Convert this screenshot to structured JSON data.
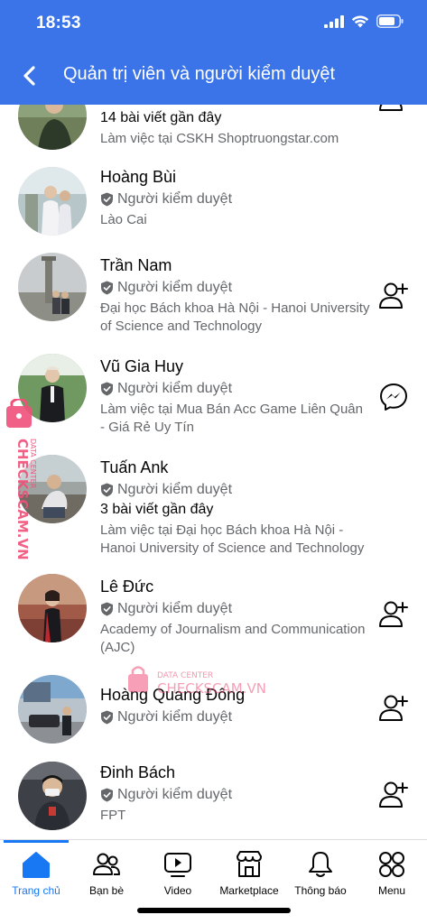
{
  "status": {
    "time": "18:53"
  },
  "header": {
    "title": "Quản trị viên và người kiểm duyệt"
  },
  "members": [
    {
      "name": "",
      "posts": "14 bài viết gần đây",
      "meta": "Làm việc tại CSKH Shoptruongstar.com",
      "action": "add-friend"
    },
    {
      "name": "Hoàng Bùi",
      "role": "Người kiểm duyệt",
      "meta": "Lào Cai",
      "action": "none"
    },
    {
      "name": "Trần Nam",
      "role": "Người kiểm duyệt",
      "meta": "Đại học Bách khoa Hà Nội - Hanoi University of Science and Technology",
      "action": "add-friend"
    },
    {
      "name": "Vũ Gia Huy",
      "role": "Người kiểm duyệt",
      "meta": "Làm việc tại Mua Bán Acc Game Liên Quân - Giá Rẻ Uy Tín",
      "action": "messenger"
    },
    {
      "name": "Tuấn Ank",
      "role": "Người kiểm duyệt",
      "posts": "3 bài viết gần đây",
      "meta": "Làm việc tại Đại học Bách khoa Hà Nội - Hanoi University of Science and Technology",
      "action": "none"
    },
    {
      "name": "Lê Đức",
      "role": "Người kiểm duyệt",
      "meta": "Academy of Journalism and Communication (AJC)",
      "action": "add-friend"
    },
    {
      "name": "Hoàng Quang Đông",
      "role": "Người kiểm duyệt",
      "meta": "",
      "action": "add-friend"
    },
    {
      "name": "Đinh Bách",
      "role": "Người kiểm duyệt",
      "meta": "FPT",
      "action": "add-friend"
    }
  ],
  "watermark": {
    "line1": "DATA CENTER",
    "line2": "CHECKSCAM.VN"
  },
  "tabs": [
    {
      "label": "Trang chủ",
      "icon": "home-icon",
      "active": true
    },
    {
      "label": "Bạn bè",
      "icon": "friends-icon"
    },
    {
      "label": "Video",
      "icon": "video-icon"
    },
    {
      "label": "Marketplace",
      "icon": "marketplace-icon"
    },
    {
      "label": "Thông báo",
      "icon": "bell-icon"
    },
    {
      "label": "Menu",
      "icon": "menu-grid-icon"
    }
  ],
  "colors": {
    "brand": "#3b74e8",
    "active_tab": "#1877f2",
    "watermark": "#f0507a"
  }
}
